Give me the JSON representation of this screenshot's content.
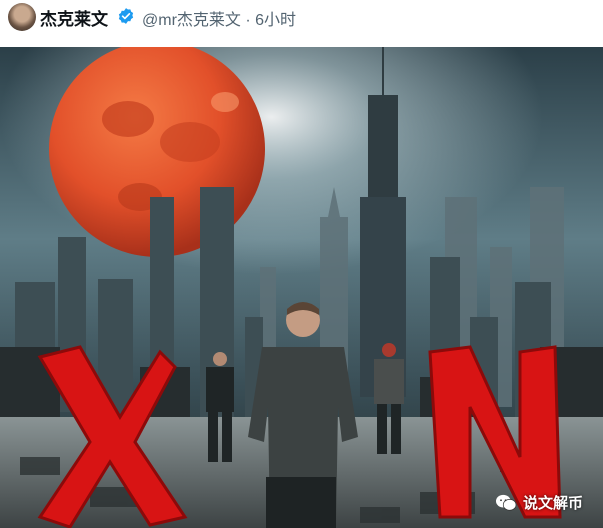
{
  "post": {
    "author_name": "杰克莱文",
    "handle_time": "@mr杰克莱文 · 6小时",
    "verified_icon": "verified-badge-icon"
  },
  "image": {
    "letters": [
      "X",
      "N"
    ],
    "watermark": "说文解币",
    "colors": {
      "moon": "#e2502a",
      "sky": "#3b5560",
      "letters": "#d81414"
    }
  }
}
